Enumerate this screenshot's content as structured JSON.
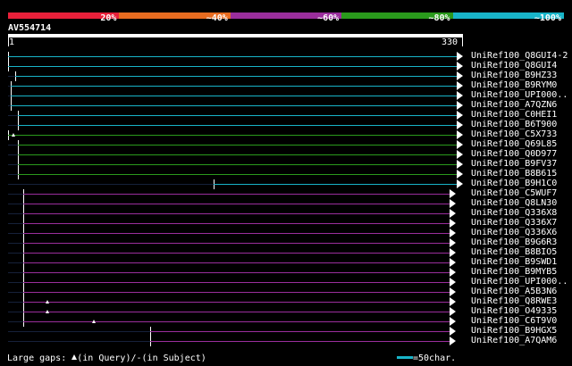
{
  "legend": {
    "segments": [
      {
        "label": "20%",
        "color": "#e8203a"
      },
      {
        "label": "~40%",
        "color": "#e86c20"
      },
      {
        "label": "~60%",
        "color": "#9a2e9c"
      },
      {
        "label": "~80%",
        "color": "#2a9a1c"
      },
      {
        "label": "~100%",
        "color": "#18b4c8"
      }
    ]
  },
  "query": {
    "id": "AV554714",
    "start": "1",
    "end": "330",
    "length": 330
  },
  "hits": [
    {
      "id": "UniRef100_Q8GUI4-2",
      "start": 1,
      "end": 330,
      "color": "#18b4c8",
      "gaps": []
    },
    {
      "id": "UniRef100_Q8GUI4",
      "start": 1,
      "end": 330,
      "color": "#18b4c8",
      "gaps": []
    },
    {
      "id": "UniRef100_B9HZ33",
      "start": 6,
      "end": 330,
      "color": "#18b4c8",
      "gaps": []
    },
    {
      "id": "UniRef100_B9RYM0",
      "start": 3,
      "end": 330,
      "color": "#18b4c8",
      "gaps": []
    },
    {
      "id": "UniRef100_UPI000..",
      "start": 3,
      "end": 330,
      "color": "#18b4c8",
      "gaps": []
    },
    {
      "id": "UniRef100_A7QZN6",
      "start": 3,
      "end": 330,
      "color": "#18b4c8",
      "gaps": []
    },
    {
      "id": "UniRef100_C0HEI1",
      "start": 8,
      "end": 330,
      "color": "#18b4c8",
      "gaps": []
    },
    {
      "id": "UniRef100_B6T900",
      "start": 8,
      "end": 330,
      "color": "#18b4c8",
      "gaps": []
    },
    {
      "id": "UniRef100_C5X733",
      "start": 1,
      "end": 330,
      "color": "#2a9a1c",
      "gaps": [
        5
      ]
    },
    {
      "id": "UniRef100_Q69L85",
      "start": 8,
      "end": 330,
      "color": "#2a9a1c",
      "gaps": []
    },
    {
      "id": "UniRef100_Q0D977",
      "start": 8,
      "end": 330,
      "color": "#2a9a1c",
      "gaps": []
    },
    {
      "id": "UniRef100_B9FV37",
      "start": 8,
      "end": 330,
      "color": "#2a9a1c",
      "gaps": []
    },
    {
      "id": "UniRef100_B8B615",
      "start": 8,
      "end": 330,
      "color": "#2a9a1c",
      "gaps": []
    },
    {
      "id": "UniRef100_B9H1C0",
      "start": 152,
      "end": 330,
      "color": "#18b4c8",
      "gaps": []
    },
    {
      "id": "UniRef100_C5WUF7",
      "start": 12,
      "end": 325,
      "color": "#9a2e9c",
      "gaps": []
    },
    {
      "id": "UniRef100_Q8LN30",
      "start": 12,
      "end": 325,
      "color": "#9a2e9c",
      "gaps": []
    },
    {
      "id": "UniRef100_Q336X8",
      "start": 12,
      "end": 325,
      "color": "#9a2e9c",
      "gaps": []
    },
    {
      "id": "UniRef100_Q336X7",
      "start": 12,
      "end": 325,
      "color": "#9a2e9c",
      "gaps": []
    },
    {
      "id": "UniRef100_Q336X6",
      "start": 12,
      "end": 325,
      "color": "#9a2e9c",
      "gaps": []
    },
    {
      "id": "UniRef100_B9G6R3",
      "start": 12,
      "end": 325,
      "color": "#9a2e9c",
      "gaps": []
    },
    {
      "id": "UniRef100_B8BIO5",
      "start": 12,
      "end": 325,
      "color": "#9a2e9c",
      "gaps": []
    },
    {
      "id": "UniRef100_B9SWD1",
      "start": 12,
      "end": 325,
      "color": "#9a2e9c",
      "gaps": []
    },
    {
      "id": "UniRef100_B9MYB5",
      "start": 12,
      "end": 325,
      "color": "#9a2e9c",
      "gaps": []
    },
    {
      "id": "UniRef100_UPI000..",
      "start": 12,
      "end": 325,
      "color": "#9a2e9c",
      "gaps": []
    },
    {
      "id": "UniRef100_A5B3N6",
      "start": 12,
      "end": 325,
      "color": "#9a2e9c",
      "gaps": []
    },
    {
      "id": "UniRef100_Q8RWE3",
      "start": 12,
      "end": 325,
      "color": "#9a2e9c",
      "gaps": [
        30
      ]
    },
    {
      "id": "UniRef100_O49335",
      "start": 12,
      "end": 325,
      "color": "#9a2e9c",
      "gaps": [
        30
      ]
    },
    {
      "id": "UniRef100_C6T9V0",
      "start": 12,
      "end": 325,
      "color": "#9a2e9c",
      "gaps": [
        64
      ]
    },
    {
      "id": "UniRef100_B9HGX5",
      "start": 105,
      "end": 325,
      "color": "#9a2e9c",
      "gaps": []
    },
    {
      "id": "UniRef100_A7QAM6",
      "start": 105,
      "end": 325,
      "color": "#9a2e9c",
      "gaps": []
    }
  ],
  "footer": {
    "prefix": "Large gaps:",
    "query_text": "(in Query)/",
    "subject_text": "(in Subject)",
    "scale_text": "=50char.",
    "scale_color": "#18b4c8"
  }
}
